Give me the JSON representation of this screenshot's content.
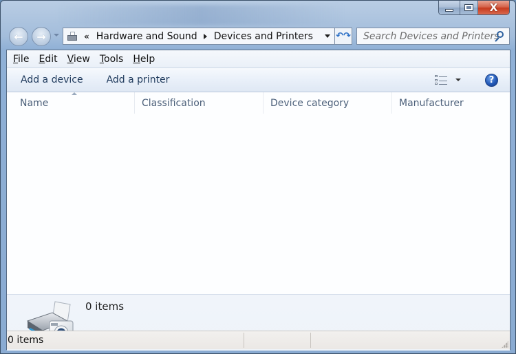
{
  "window": {
    "caption_buttons": {
      "minimize_icon": "minimize-icon",
      "maximize_icon": "maximize-icon",
      "close_icon": "close-icon",
      "close_glyph": "X"
    }
  },
  "navigation": {
    "back_icon": "back-arrow-icon",
    "back_glyph": "←",
    "forward_icon": "forward-arrow-icon",
    "forward_glyph": "→",
    "recent_pages_icon": "chevron-down-icon"
  },
  "address_bar": {
    "location_icon": "devices-printers-icon",
    "overflow_glyph": "«",
    "breadcrumbs": [
      {
        "label": "Hardware and Sound"
      },
      {
        "label": "Devices and Printers"
      }
    ],
    "refresh_glyph": "↶↷"
  },
  "search": {
    "placeholder": "Search Devices and Printers"
  },
  "menu": {
    "items": [
      {
        "label": "File",
        "accel": "F",
        "rest": "ile"
      },
      {
        "label": "Edit",
        "accel": "E",
        "rest": "dit"
      },
      {
        "label": "View",
        "accel": "V",
        "rest": "iew"
      },
      {
        "label": "Tools",
        "accel": "T",
        "rest": "ools"
      },
      {
        "label": "Help",
        "accel": "H",
        "rest": "elp"
      }
    ]
  },
  "command_bar": {
    "add_device": "Add a device",
    "add_printer": "Add a printer",
    "views_icon": "details-view-icon",
    "help_glyph": "?"
  },
  "list": {
    "columns": [
      {
        "label": "Name",
        "sorted": "ascending"
      },
      {
        "label": "Classification"
      },
      {
        "label": "Device category"
      },
      {
        "label": "Manufacturer"
      }
    ],
    "rows": []
  },
  "details_pane": {
    "icon": "printer-camera-icon",
    "count_text": "0 items"
  },
  "status_bar": {
    "text": "0 items"
  }
}
